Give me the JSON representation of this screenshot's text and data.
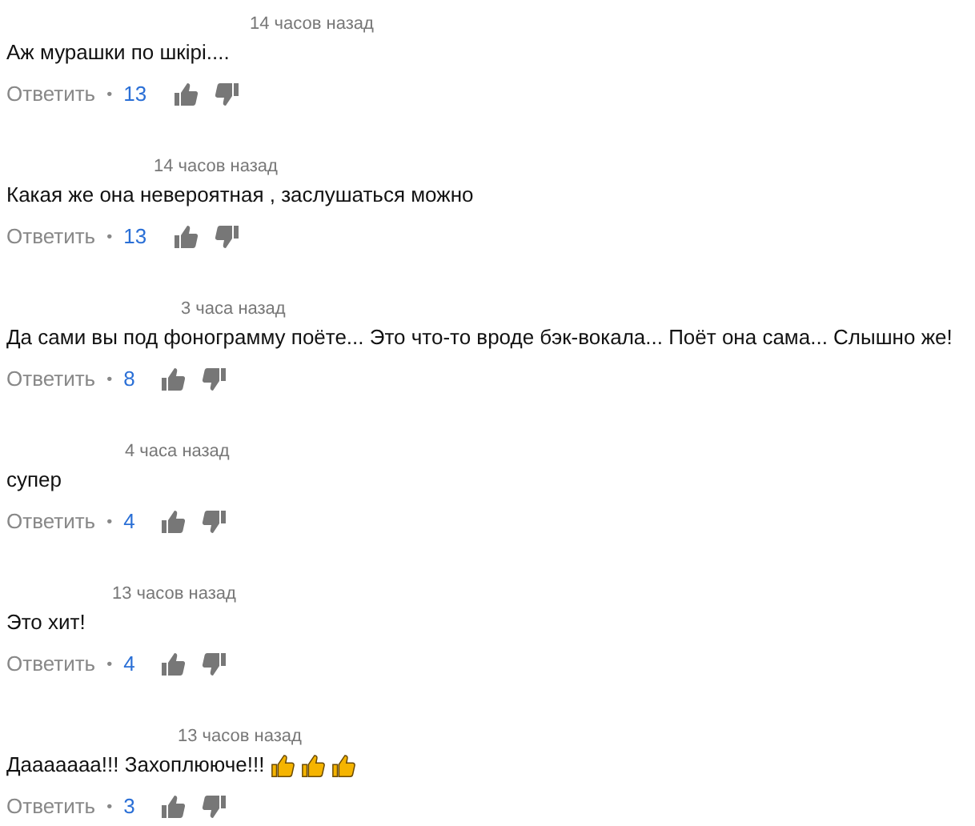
{
  "comments": [
    {
      "time": "14 часов назад",
      "text": "Аж мурашки по шкірі....",
      "reply": "Ответить",
      "separator": "•",
      "likes": "13"
    },
    {
      "time": "14 часов назад",
      "text": "Какая же она невероятная , заслушаться можно",
      "reply": "Ответить",
      "separator": "•",
      "likes": "13"
    },
    {
      "time": "3 часа назад",
      "text": "Да сами вы под фонограмму поёте... Это что-то вроде бэк-вокала... Поёт она сама... Слышно же!",
      "reply": "Ответить",
      "separator": "•",
      "likes": "8"
    },
    {
      "time": "4 часа назад",
      "text": "супер",
      "reply": "Ответить",
      "separator": "•",
      "likes": "4"
    },
    {
      "time": "13 часов назад",
      "text": "Это хит!",
      "reply": "Ответить",
      "separator": "•",
      "likes": "4"
    },
    {
      "time": "13 часов назад",
      "text": "Дааааааа!!! Захоплююче!!!",
      "emojis": [
        {
          "kind": "thumbs-up"
        },
        {
          "kind": "thumbs-up"
        },
        {
          "kind": "thumbs-up"
        }
      ],
      "reply": "Ответить",
      "separator": "•",
      "likes": "3"
    }
  ]
}
